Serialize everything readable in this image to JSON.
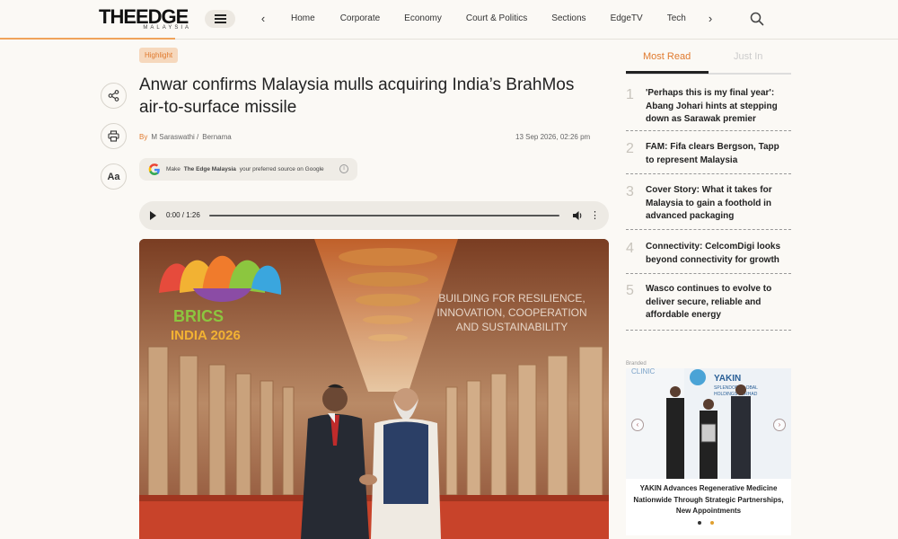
{
  "header": {
    "logo_main": "THEEDGE",
    "logo_sub": "MALAYSIA",
    "nav": [
      "Home",
      "Corporate",
      "Economy",
      "Court & Politics",
      "Sections",
      "EdgeTV",
      "Tech"
    ],
    "accent": "#f0a35a"
  },
  "article": {
    "badge": "Highlight",
    "title": "Anwar confirms Malaysia mulls acquiring India’s BrahMos air-to-surface missile",
    "by_label": "By",
    "author": "M Saraswathi /",
    "source": "Bernama",
    "date": "13 Sep 2026, 02:26 pm",
    "google_prefix": "Make",
    "google_brand": "The Edge Malaysia",
    "google_suffix": "your preferred source on Google",
    "audio_time": "0:00 / 1:26",
    "font_button": "Aa",
    "hero": {
      "logo_letters": "BRICS",
      "logo_year": "INDIA 2026",
      "banner_lines": [
        "BUILDING FOR RESILIENCE,",
        "INNOVATION, COOPERATION",
        "AND SUSTAINABILITY"
      ]
    }
  },
  "sidebar": {
    "tab_most_read": "Most Read",
    "tab_just_in": "Just In",
    "most_read": [
      {
        "num": "1",
        "text": "'Perhaps this is my final year': Abang Johari hints at stepping down as Sarawak premier"
      },
      {
        "num": "2",
        "text": "FAM: Fifa clears Bergson, Tapp to represent Malaysia"
      },
      {
        "num": "3",
        "text": "Cover Story: What it takes for Malaysia to gain a foothold in advanced packaging"
      },
      {
        "num": "4",
        "text": "Connectivity: CelcomDigi looks beyond connectivity for growth"
      },
      {
        "num": "5",
        "text": "Wasco continues to evolve to deliver secure, reliable and affordable energy"
      }
    ],
    "branded_label": "Branded",
    "branded_caption": "YAKIN Advances Regenerative Medicine Nationwide Through Strategic Partnerships, New Appointments",
    "branded_img_text": [
      "YAKIN",
      "SPLENDOR GLOBAL",
      "HOLDINGS BERHAD"
    ],
    "branded_corner_text": "CLINIC"
  }
}
